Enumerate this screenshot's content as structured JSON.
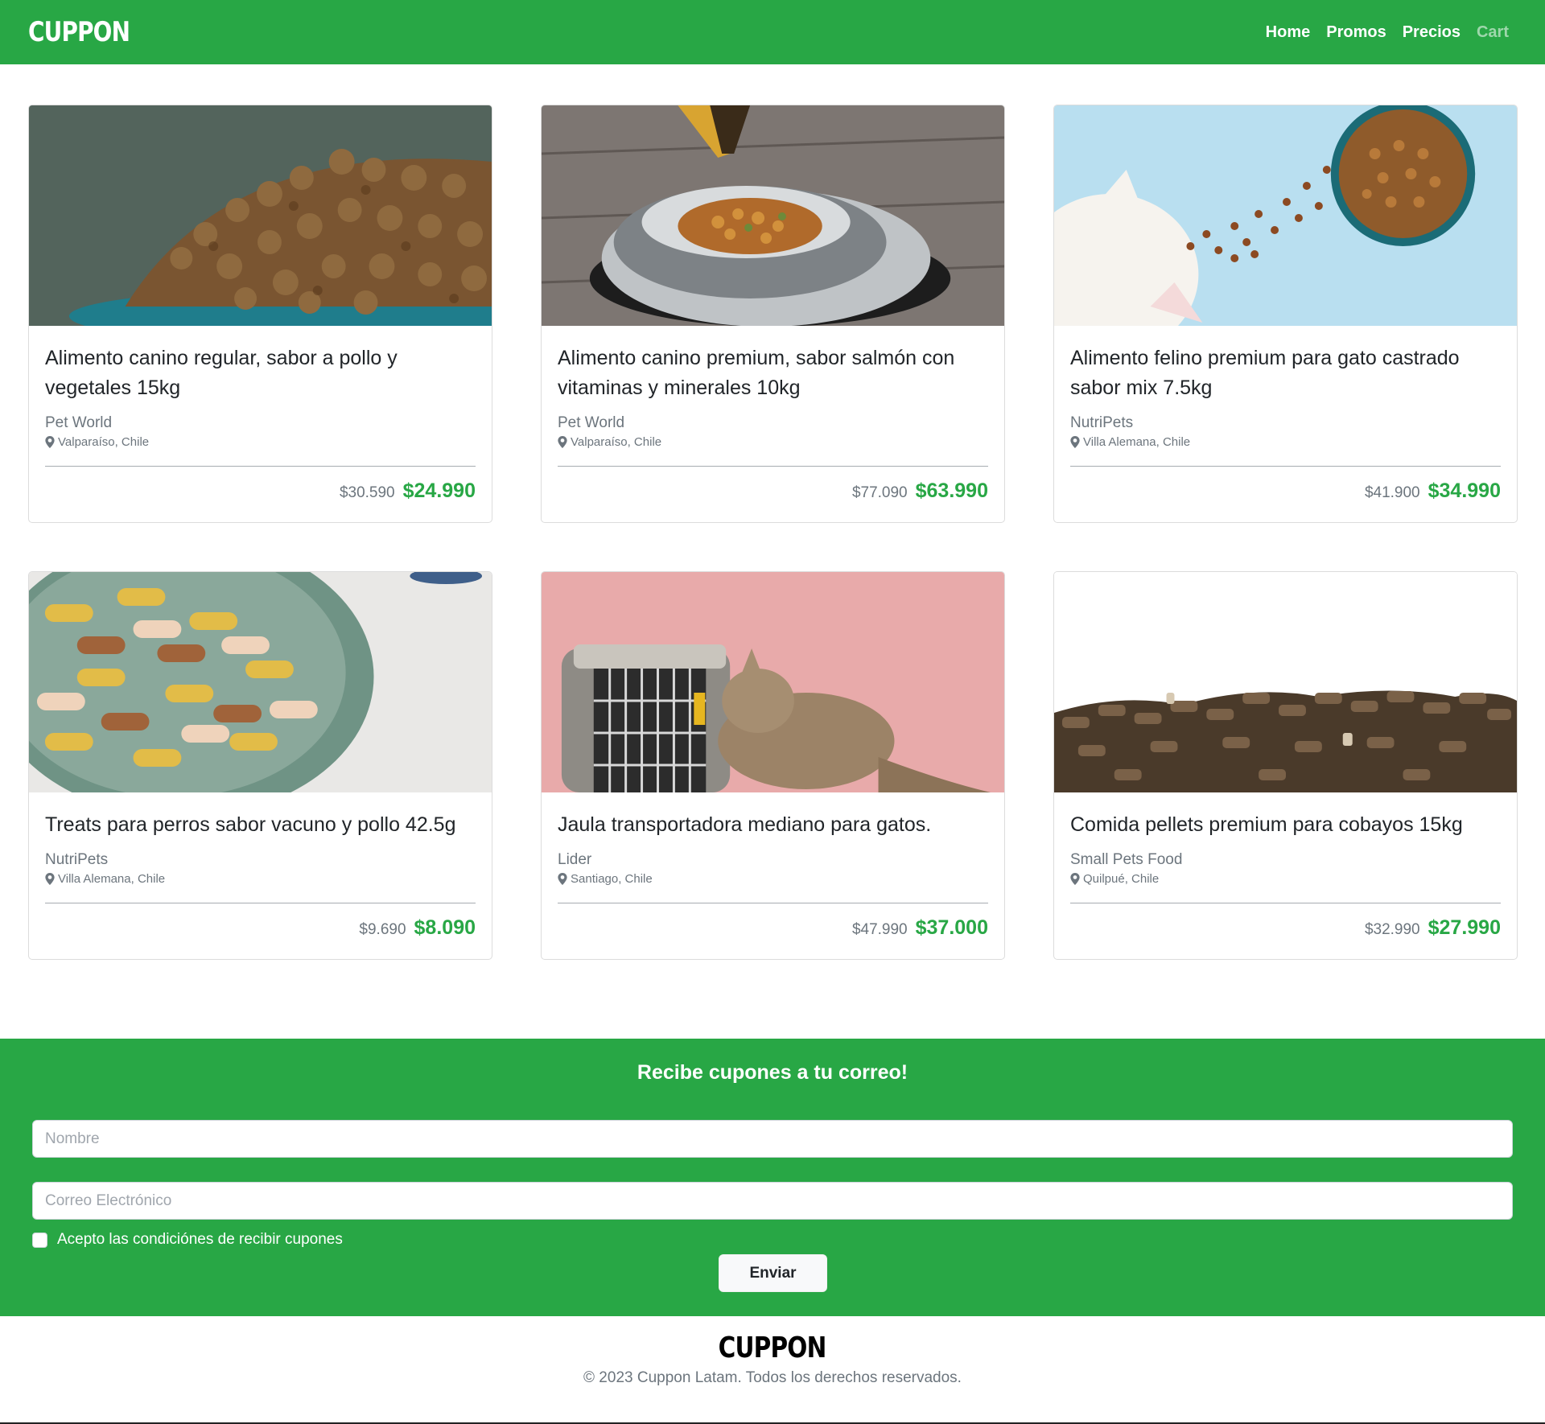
{
  "brand": "CUPPON",
  "nav": {
    "links": [
      "Home",
      "Promos",
      "Precios",
      "Cart"
    ],
    "active_muted": "Cart"
  },
  "colors": {
    "primary_green": "#28a745",
    "text_muted": "#6c757d"
  },
  "products": [
    {
      "title": "Alimento canino regular, sabor a pollo y vegetales 15kg",
      "vendor": "Pet World",
      "location": "Valparaíso, Chile",
      "old_price": "$30.590",
      "price": "$24.990",
      "image": "dog-kibble-bowl"
    },
    {
      "title": "Alimento canino premium, sabor salmón con vitaminas y minerales 10kg",
      "vendor": "Pet World",
      "location": "Valparaíso, Chile",
      "old_price": "$77.090",
      "price": "$63.990",
      "image": "steel-bowl-kibble"
    },
    {
      "title": "Alimento felino premium para gato castrado sabor mix 7.5kg",
      "vendor": "NutriPets",
      "location": "Villa Alemana, Chile",
      "old_price": "$41.900",
      "price": "$34.990",
      "image": "cat-and-bowl"
    },
    {
      "title": "Treats para perros sabor vacuno y pollo 42.5g",
      "vendor": "NutriPets",
      "location": "Villa Alemana, Chile",
      "old_price": "$9.690",
      "price": "$8.090",
      "image": "bone-treats-bowl"
    },
    {
      "title": "Jaula transportadora mediano para gatos.",
      "vendor": "Lider",
      "location": "Santiago, Chile",
      "old_price": "$47.990",
      "price": "$37.000",
      "image": "cat-carrier"
    },
    {
      "title": "Comida pellets premium para cobayos 15kg",
      "vendor": "Small Pets Food",
      "location": "Quilpué, Chile",
      "old_price": "$32.990",
      "price": "$27.990",
      "image": "pellets"
    }
  ],
  "subscribe": {
    "title": "Recibe cupones a tu correo!",
    "name_placeholder": "Nombre",
    "email_placeholder": "Correo Electrónico",
    "checkbox_label": "Acepto las condiciónes de recibir cupones",
    "submit_label": "Enviar"
  },
  "footer": {
    "brand": "CUPPON",
    "copyright": "© 2023 Cuppon Latam. Todos los derechos reservados."
  }
}
